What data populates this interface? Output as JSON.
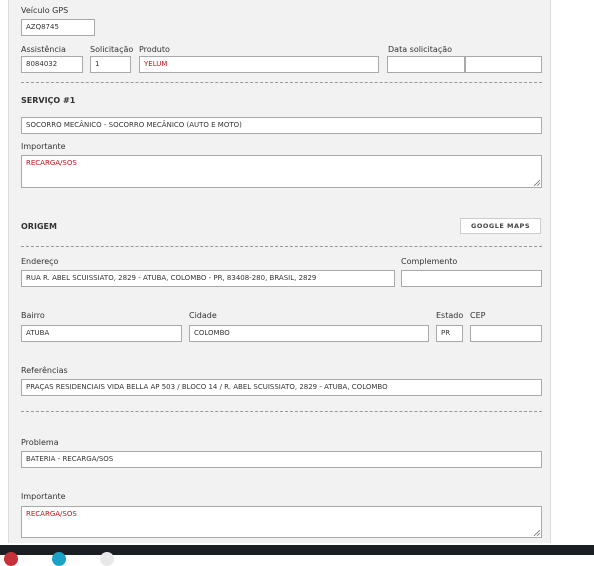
{
  "vehicle": {
    "label": "Veículo GPS",
    "value": "AZQ8745"
  },
  "request": {
    "assistencia_label": "Assistência",
    "assistencia_value": "8084032",
    "solicitacao_label": "Solicitação",
    "solicitacao_value": "1",
    "produto_label": "Produto",
    "produto_value": "YELUM",
    "data_label": "Data solicitação",
    "data_value": "",
    "hora_value": ""
  },
  "service": {
    "title": "SERVIÇO #1",
    "value": "SOCORRO MECÂNICO - SOCORRO MECÂNICO (AUTO E MOTO)",
    "importante_label": "Importante",
    "importante_value": "RECARGA/SOS"
  },
  "origin": {
    "title": "ORIGEM",
    "maps_button": "GOOGLE MAPS",
    "endereco_label": "Endereço",
    "endereco_value": "RUA R. ABEL SCUISSIATO, 2829 - ATUBA, COLOMBO - PR, 83408-280, BRASIL, 2829",
    "complemento_label": "Complemento",
    "complemento_value": "",
    "bairro_label": "Bairro",
    "bairro_value": "ATUBA",
    "cidade_label": "Cidade",
    "cidade_value": "COLOMBO",
    "estado_label": "Estado",
    "estado_value": "PR",
    "cep_label": "CEP",
    "cep_value": "",
    "referencias_label": "Referências",
    "referencias_value": "PRAÇAS RESIDENCIAIS VIDA BELLA AP 503 / BLOCO 14 /  R. ABEL SCUISSIATO, 2829 - ATUBA, COLOMBO"
  },
  "problem": {
    "label": "Problema",
    "value": "BATERIA - RECARGA/SOS",
    "importante_label": "Importante",
    "importante_value": "RECARGA/SOS"
  }
}
